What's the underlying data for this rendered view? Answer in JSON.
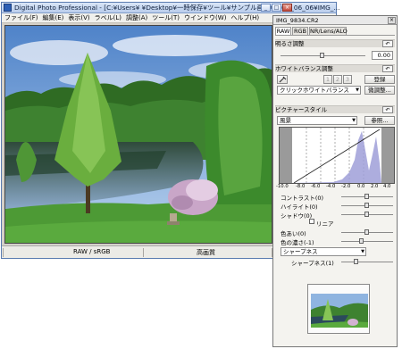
{
  "window": {
    "title": "Digital Photo Professional - [C:¥Users¥         ¥Desktop¥一時保存¥ツール¥サンプル画像¥2006_06_06¥IMG_...",
    "minimize_glyph": "_",
    "maximize_glyph": "□",
    "close_glyph": "×"
  },
  "menu": [
    "ファイル(F)",
    "編集(E)",
    "表示(V)",
    "ラベル(L)",
    "調整(A)",
    "ツール(T)",
    "ウインドウ(W)",
    "ヘルプ(H)"
  ],
  "status": {
    "color_mode": "RAW / sRGB",
    "quality": "高画質"
  },
  "palette": {
    "filename": "IMG_9834.CR2",
    "close_glyph": "×",
    "tabs": [
      "RAW",
      "RGB",
      "NR/Lens/ALO"
    ],
    "brightness": {
      "header": "明るさ調整",
      "value": "0.00"
    },
    "white_balance": {
      "header": "ホワイトバランス調整",
      "preset_numbers": [
        "1",
        "2",
        "3"
      ],
      "register_button": "登録",
      "mode": "クリックホワイトバランス",
      "fine_tune_button": "微調整..."
    },
    "picture_style": {
      "header": "ピクチャースタイル",
      "style": "風景",
      "browse_button": "参照...",
      "axis_ticks": [
        "-10.0",
        "-8.0",
        "-6.0",
        "-4.0",
        "-2.0",
        "0.0",
        "2.0",
        "4.0"
      ],
      "sliders": [
        {
          "label": "コントラスト(0)",
          "level": 0.5
        },
        {
          "label": "ハイライト(0)",
          "level": 0.5
        },
        {
          "label": "シャドウ(0)",
          "level": 0.5
        },
        {
          "label": "色あい(0)",
          "level": 0.5
        },
        {
          "label": "色の濃さ(-1)",
          "level": 0.4
        }
      ],
      "linear_label": "リニア",
      "sharpness_mode": "シャープネス",
      "sharpness_label": "シャープネス(1)",
      "sharpness_level": 0.3
    },
    "reset_glyph": "↶"
  },
  "colors": {
    "title_bar": "#b9cdec",
    "sky": "#7fa6d8",
    "grass": "#4d9a35"
  }
}
